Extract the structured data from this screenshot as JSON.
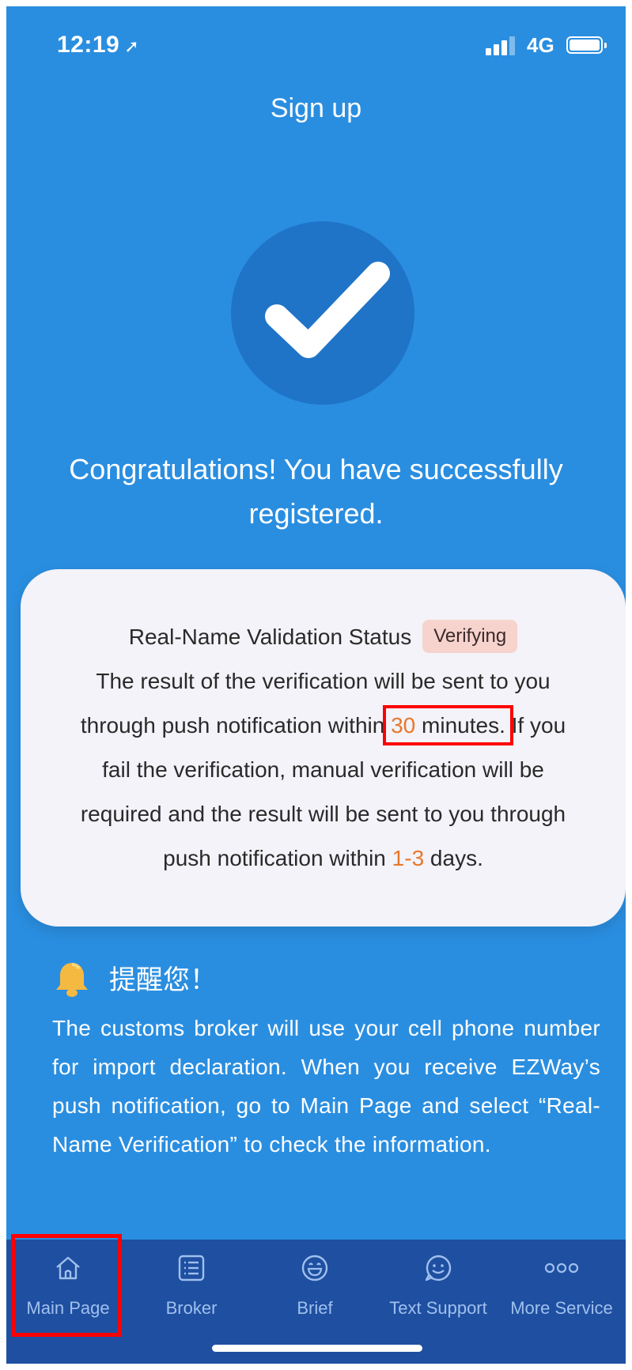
{
  "status_bar": {
    "time": "12:19",
    "network": "4G"
  },
  "header": {
    "title": "Sign up"
  },
  "success": {
    "message": "Congratulations! You have successfully registered."
  },
  "validation_card": {
    "status_label": "Real-Name Validation Status",
    "status_badge": "Verifying",
    "line1": "The result of the verification will be sent to you",
    "line2_prefix": "through push notification within ",
    "minutes_value": "30",
    "minutes_unit": " minutes.",
    "line2_suffix": " If you",
    "line3": "fail the verification, manual verification will be",
    "line4": "required and the result will be sent to you through",
    "line5_prefix": "push notification within ",
    "days_value": "1-3",
    "line5_suffix": " days."
  },
  "reminder": {
    "title": "提醒您！",
    "text": "The customs broker will use your cell phone number for import declaration. When you receive EZWay’s push notification, go to Main Page and select “Real-Name Verification” to check the information."
  },
  "tabs": [
    {
      "label": "Main Page",
      "icon": "home-icon"
    },
    {
      "label": "Broker",
      "icon": "list-icon"
    },
    {
      "label": "Brief",
      "icon": "smile-icon"
    },
    {
      "label": "Text Support",
      "icon": "chat-smile-icon"
    },
    {
      "label": "More Service",
      "icon": "more-icon"
    }
  ],
  "colors": {
    "background": "#2a8ee0",
    "tabbar": "#1f4fa0",
    "accent_orange": "#e8772c",
    "badge_bg": "#f7d3cd",
    "highlight": "#ff0000"
  }
}
